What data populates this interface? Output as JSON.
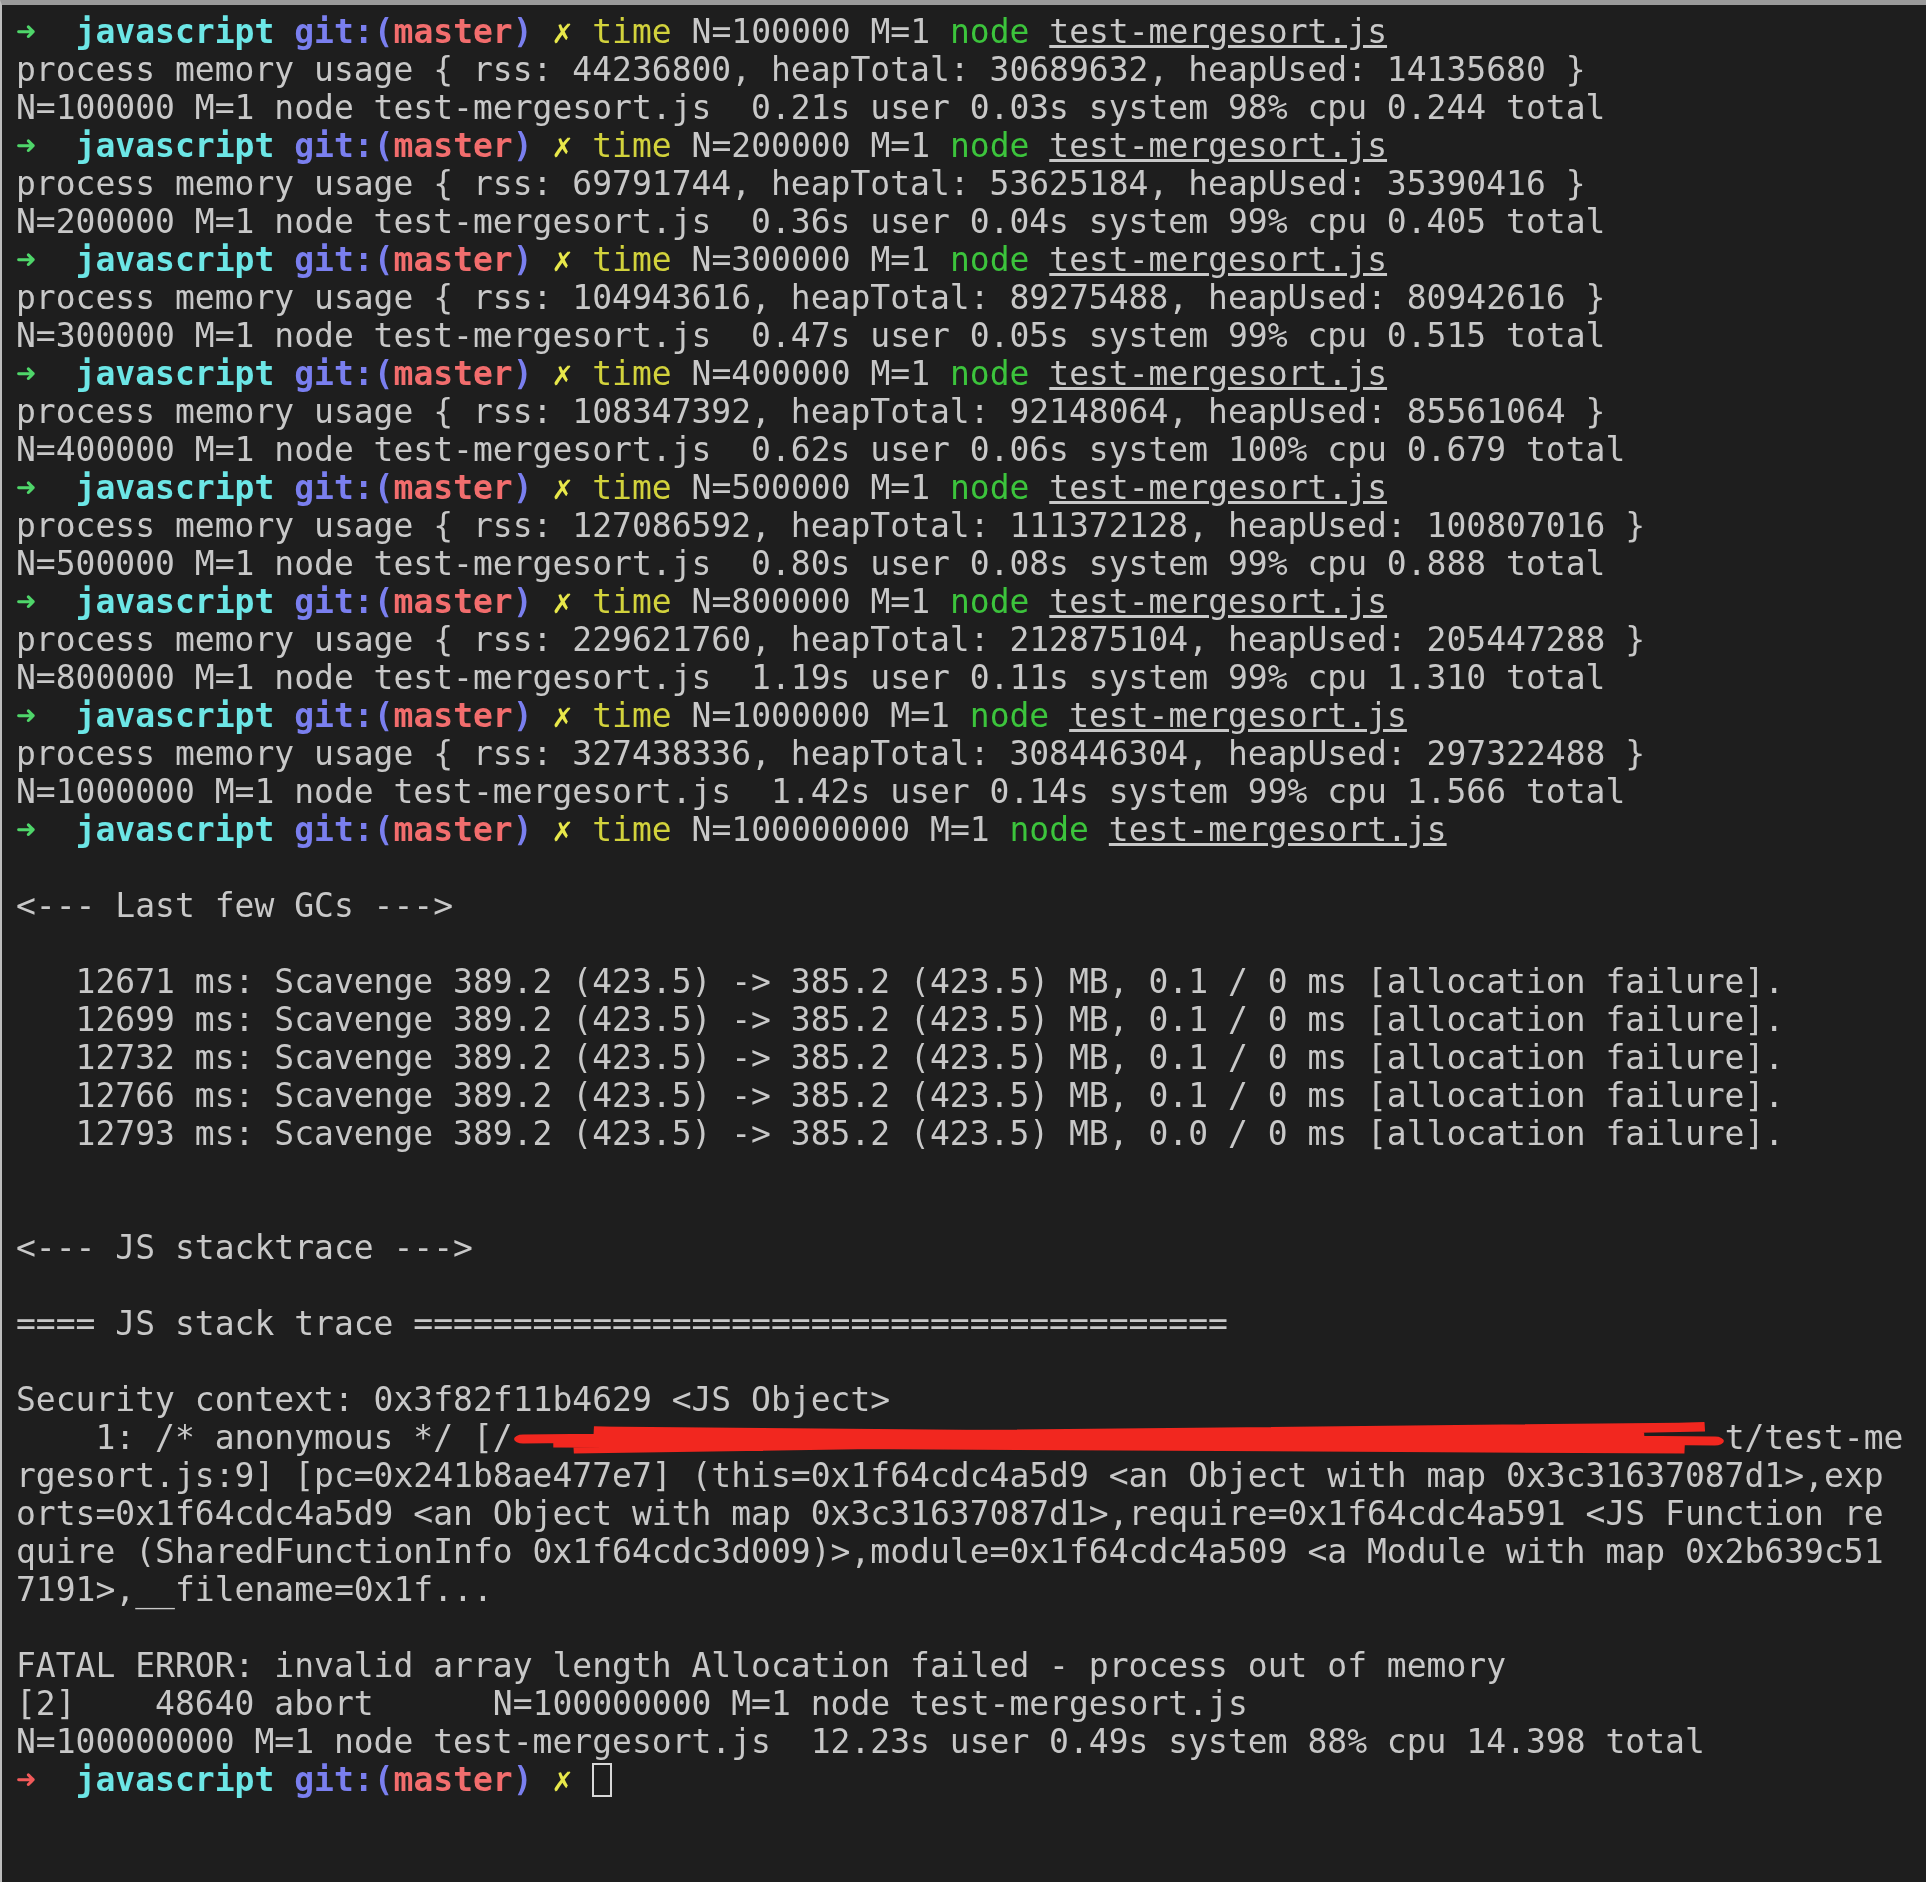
{
  "terminal": {
    "lines": [
      {
        "kind": "prompt",
        "success": true,
        "arrow": "➜",
        "dir": "javascript",
        "git_open": "git:(",
        "branch": "master",
        "git_close": ")",
        "dirty": "✗",
        "cmd_prefix": "time",
        "cmd_env": "N=100000 M=1",
        "cmd_bin": "node",
        "cmd_file": "test-mergesort.js"
      },
      {
        "kind": "output",
        "text": "process memory usage { rss: 44236800, heapTotal: 30689632, heapUsed: 14135680 }"
      },
      {
        "kind": "output",
        "text": "N=100000 M=1 node test-mergesort.js  0.21s user 0.03s system 98% cpu 0.244 total"
      },
      {
        "kind": "prompt",
        "success": true,
        "arrow": "➜",
        "dir": "javascript",
        "git_open": "git:(",
        "branch": "master",
        "git_close": ")",
        "dirty": "✗",
        "cmd_prefix": "time",
        "cmd_env": "N=200000 M=1",
        "cmd_bin": "node",
        "cmd_file": "test-mergesort.js"
      },
      {
        "kind": "output",
        "text": "process memory usage { rss: 69791744, heapTotal: 53625184, heapUsed: 35390416 }"
      },
      {
        "kind": "output",
        "text": "N=200000 M=1 node test-mergesort.js  0.36s user 0.04s system 99% cpu 0.405 total"
      },
      {
        "kind": "prompt",
        "success": true,
        "arrow": "➜",
        "dir": "javascript",
        "git_open": "git:(",
        "branch": "master",
        "git_close": ")",
        "dirty": "✗",
        "cmd_prefix": "time",
        "cmd_env": "N=300000 M=1",
        "cmd_bin": "node",
        "cmd_file": "test-mergesort.js"
      },
      {
        "kind": "output",
        "text": "process memory usage { rss: 104943616, heapTotal: 89275488, heapUsed: 80942616 }"
      },
      {
        "kind": "output",
        "text": "N=300000 M=1 node test-mergesort.js  0.47s user 0.05s system 99% cpu 0.515 total"
      },
      {
        "kind": "prompt",
        "success": true,
        "arrow": "➜",
        "dir": "javascript",
        "git_open": "git:(",
        "branch": "master",
        "git_close": ")",
        "dirty": "✗",
        "cmd_prefix": "time",
        "cmd_env": "N=400000 M=1",
        "cmd_bin": "node",
        "cmd_file": "test-mergesort.js"
      },
      {
        "kind": "output",
        "text": "process memory usage { rss: 108347392, heapTotal: 92148064, heapUsed: 85561064 }"
      },
      {
        "kind": "output",
        "text": "N=400000 M=1 node test-mergesort.js  0.62s user 0.06s system 100% cpu 0.679 total"
      },
      {
        "kind": "prompt",
        "success": true,
        "arrow": "➜",
        "dir": "javascript",
        "git_open": "git:(",
        "branch": "master",
        "git_close": ")",
        "dirty": "✗",
        "cmd_prefix": "time",
        "cmd_env": "N=500000 M=1",
        "cmd_bin": "node",
        "cmd_file": "test-mergesort.js"
      },
      {
        "kind": "output",
        "text": "process memory usage { rss: 127086592, heapTotal: 111372128, heapUsed: 100807016 }"
      },
      {
        "kind": "output",
        "text": "N=500000 M=1 node test-mergesort.js  0.80s user 0.08s system 99% cpu 0.888 total"
      },
      {
        "kind": "prompt",
        "success": true,
        "arrow": "➜",
        "dir": "javascript",
        "git_open": "git:(",
        "branch": "master",
        "git_close": ")",
        "dirty": "✗",
        "cmd_prefix": "time",
        "cmd_env": "N=800000 M=1",
        "cmd_bin": "node",
        "cmd_file": "test-mergesort.js"
      },
      {
        "kind": "output",
        "text": "process memory usage { rss: 229621760, heapTotal: 212875104, heapUsed: 205447288 }"
      },
      {
        "kind": "output",
        "text": "N=800000 M=1 node test-mergesort.js  1.19s user 0.11s system 99% cpu 1.310 total"
      },
      {
        "kind": "prompt",
        "success": true,
        "arrow": "➜",
        "dir": "javascript",
        "git_open": "git:(",
        "branch": "master",
        "git_close": ")",
        "dirty": "✗",
        "cmd_prefix": "time",
        "cmd_env": "N=1000000 M=1",
        "cmd_bin": "node",
        "cmd_file": "test-mergesort.js"
      },
      {
        "kind": "output",
        "text": "process memory usage { rss: 327438336, heapTotal: 308446304, heapUsed: 297322488 }"
      },
      {
        "kind": "output",
        "text": "N=1000000 M=1 node test-mergesort.js  1.42s user 0.14s system 99% cpu 1.566 total"
      },
      {
        "kind": "prompt",
        "success": true,
        "arrow": "➜",
        "dir": "javascript",
        "git_open": "git:(",
        "branch": "master",
        "git_close": ")",
        "dirty": "✗",
        "cmd_prefix": "time",
        "cmd_env": "N=100000000 M=1",
        "cmd_bin": "node",
        "cmd_file": "test-mergesort.js"
      },
      {
        "kind": "blank"
      },
      {
        "kind": "output",
        "text": "<--- Last few GCs --->"
      },
      {
        "kind": "blank"
      },
      {
        "kind": "output",
        "text": "   12671 ms: Scavenge 389.2 (423.5) -> 385.2 (423.5) MB, 0.1 / 0 ms [allocation failure]."
      },
      {
        "kind": "output",
        "text": "   12699 ms: Scavenge 389.2 (423.5) -> 385.2 (423.5) MB, 0.1 / 0 ms [allocation failure]."
      },
      {
        "kind": "output",
        "text": "   12732 ms: Scavenge 389.2 (423.5) -> 385.2 (423.5) MB, 0.1 / 0 ms [allocation failure]."
      },
      {
        "kind": "output",
        "text": "   12766 ms: Scavenge 389.2 (423.5) -> 385.2 (423.5) MB, 0.1 / 0 ms [allocation failure]."
      },
      {
        "kind": "output",
        "text": "   12793 ms: Scavenge 389.2 (423.5) -> 385.2 (423.5) MB, 0.0 / 0 ms [allocation failure]."
      },
      {
        "kind": "blank"
      },
      {
        "kind": "blank"
      },
      {
        "kind": "output",
        "text": "<--- JS stacktrace --->"
      },
      {
        "kind": "blank"
      },
      {
        "kind": "output",
        "text": "==== JS stack trace ========================================="
      },
      {
        "kind": "blank"
      },
      {
        "kind": "output",
        "text": "Security context: 0x3f82f11b4629 <JS Object>"
      },
      {
        "kind": "redacted",
        "before": "    1: /* anonymous */ [/",
        "after": "t/test-me"
      },
      {
        "kind": "output",
        "text": "rgesort.js:9] [pc=0x241b8ae477e7] (this=0x1f64cdc4a5d9 <an Object with map 0x3c31637087d1>,exp"
      },
      {
        "kind": "output",
        "text": "orts=0x1f64cdc4a5d9 <an Object with map 0x3c31637087d1>,require=0x1f64cdc4a591 <JS Function re"
      },
      {
        "kind": "output",
        "text": "quire (SharedFunctionInfo 0x1f64cdc3d009)>,module=0x1f64cdc4a509 <a Module with map 0x2b639c51"
      },
      {
        "kind": "output",
        "text": "7191>,__filename=0x1f..."
      },
      {
        "kind": "blank"
      },
      {
        "kind": "output",
        "text": "FATAL ERROR: invalid array length Allocation failed - process out of memory"
      },
      {
        "kind": "output",
        "text": "[2]    48640 abort      N=100000000 M=1 node test-mergesort.js"
      },
      {
        "kind": "output",
        "text": "N=100000000 M=1 node test-mergesort.js  12.23s user 0.49s system 88% cpu 14.398 total"
      },
      {
        "kind": "prompt",
        "success": false,
        "arrow": "➜",
        "dir": "javascript",
        "git_open": "git:(",
        "branch": "master",
        "git_close": ")",
        "dirty": "✗",
        "cursor": true
      }
    ]
  }
}
